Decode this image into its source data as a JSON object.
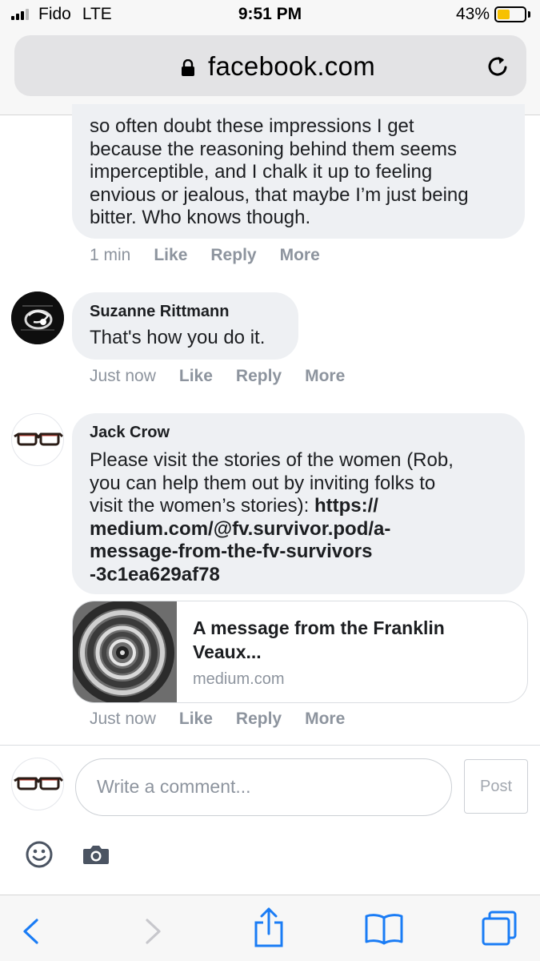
{
  "status_bar": {
    "carrier": "Fido",
    "network": "LTE",
    "time": "9:51 PM",
    "battery_percent": "43%",
    "battery_level": 0.43,
    "signal_bars_filled": 3
  },
  "url_bar": {
    "domain": "facebook.com",
    "icons": [
      "lock-icon",
      "reload-icon"
    ]
  },
  "comments": [
    {
      "author": "",
      "lines": [
        "so often doubt these impressions I get",
        "because the reasoning behind them seems",
        "imperceptible, and I chalk it up to feeling",
        "envious or jealous, that maybe I’m just being",
        "bitter. Who knows though."
      ],
      "time": "1 min",
      "like": "Like",
      "reply": "Reply",
      "more": "More"
    },
    {
      "author": "Suzanne Rittmann",
      "lines": [
        "That's how you do it."
      ],
      "time": "Just now",
      "like": "Like",
      "reply": "Reply",
      "more": "More"
    },
    {
      "author": "Jack Crow",
      "lines": [
        "Please visit the stories of the women (Rob,",
        "you can help them out by inviting folks to",
        "visit the women’s stories): ",
        "medium.com/@fv.survivor.pod/a-",
        "message-from-the-fv-survivors",
        "-3c1ea629af78"
      ],
      "link_start": "https://",
      "time": "Just now",
      "like": "Like",
      "reply": "Reply",
      "more": "More",
      "preview": {
        "title_line1": "A message from the Franklin",
        "title_line2": "Veaux...",
        "domain": "medium.com"
      }
    }
  ],
  "composer": {
    "placeholder": "Write a comment...",
    "post_label": "Post",
    "icons": [
      "smile-icon",
      "camera-icon"
    ]
  },
  "toolbar": {
    "icons": [
      "back-icon",
      "forward-icon",
      "share-icon",
      "bookmarks-icon",
      "tabs-icon"
    ]
  },
  "colors": {
    "bubble_bg": "#eef0f3",
    "meta_text": "#8d949e",
    "battery_fill": "#f7c100",
    "ios_blue": "#1a7cf5",
    "fb_icon": "#4b5462"
  }
}
